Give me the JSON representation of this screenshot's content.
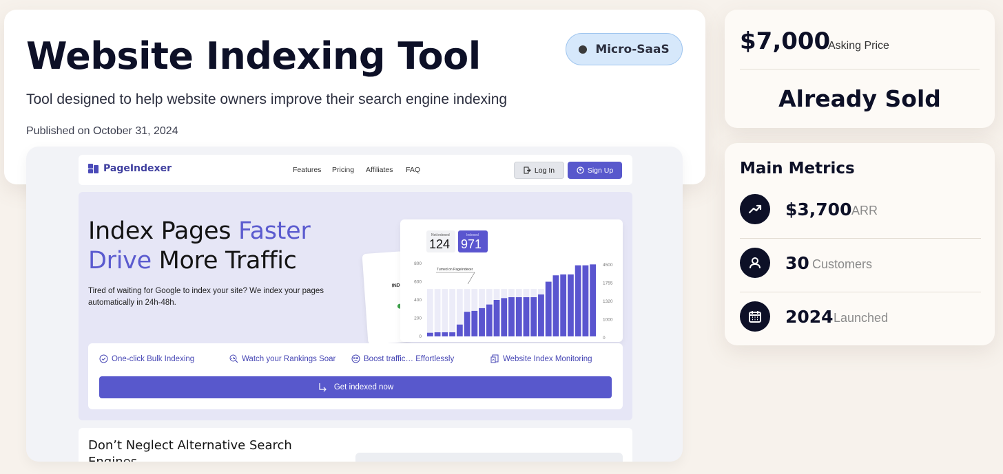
{
  "listing": {
    "title": "Website Indexing Tool",
    "subtitle": "Tool designed to help website owners improve their search engine indexing",
    "published": "Published on October 31, 2024",
    "category": "Micro-SaaS"
  },
  "price": {
    "amount": "$7,000",
    "label": "Asking Price",
    "status": "Already Sold"
  },
  "metrics": {
    "title": "Main Metrics",
    "items": [
      {
        "value": "$3,700",
        "label": "ARR",
        "icon": "trending-up-icon"
      },
      {
        "value": "30",
        "label": "Customers",
        "icon": "user-icon"
      },
      {
        "value": "2024",
        "label": "Launched",
        "icon": "calendar-icon"
      }
    ]
  },
  "preview": {
    "logo": "PageIndexer",
    "nav_links": [
      "Features",
      "Pricing",
      "Affiliates",
      "FAQ"
    ],
    "login": "Log In",
    "signup": "Sign Up",
    "hero_line1_plain": "Index Pages ",
    "hero_line1_accent": "Faster",
    "hero_line2_accent": "Drive",
    "hero_line2_plain": " More Traffic",
    "hero_desc": "Tired of waiting for Google to index your site? We index your pages automatically in 24h-48h.",
    "features": [
      "One-click Bulk Indexing",
      "Watch your Rankings Soar",
      "Boost traffic… Effortlessly",
      "Website Index Monitoring"
    ],
    "cta": "Get indexed now",
    "section2_title": "Don’t Neglect Alternative Search Engines",
    "ghost_card_text": "IND"
  },
  "chart_data": {
    "type": "bar",
    "stat_not_indexed_label": "Not indexed",
    "stat_not_indexed": "124",
    "stat_indexed_label": "Indexed",
    "stat_indexed": "971",
    "annotation": "Turned on PageIndexer",
    "left_ticks": [
      "800",
      "600",
      "400",
      "200",
      "0"
    ],
    "right_ticks": [
      "4500",
      "1755",
      "1320",
      "1000",
      "0"
    ],
    "ylim": [
      0,
      800
    ],
    "values": [
      40,
      45,
      45,
      45,
      130,
      270,
      280,
      310,
      350,
      400,
      420,
      430,
      430,
      430,
      430,
      460,
      600,
      670,
      680,
      680,
      780,
      780,
      790
    ],
    "background_values": [
      520,
      520,
      520,
      520,
      520,
      520,
      520,
      520,
      520,
      520,
      520,
      520,
      520,
      520,
      520,
      520,
      520,
      520,
      520,
      520,
      520,
      520,
      520
    ],
    "colors": {
      "indexed": "#5a55cf",
      "not_indexed": "#ececf8"
    }
  },
  "colors": {
    "accent": "#5b5bcf",
    "dark": "#0d1027",
    "badge_bg": "#d6e8fb"
  }
}
